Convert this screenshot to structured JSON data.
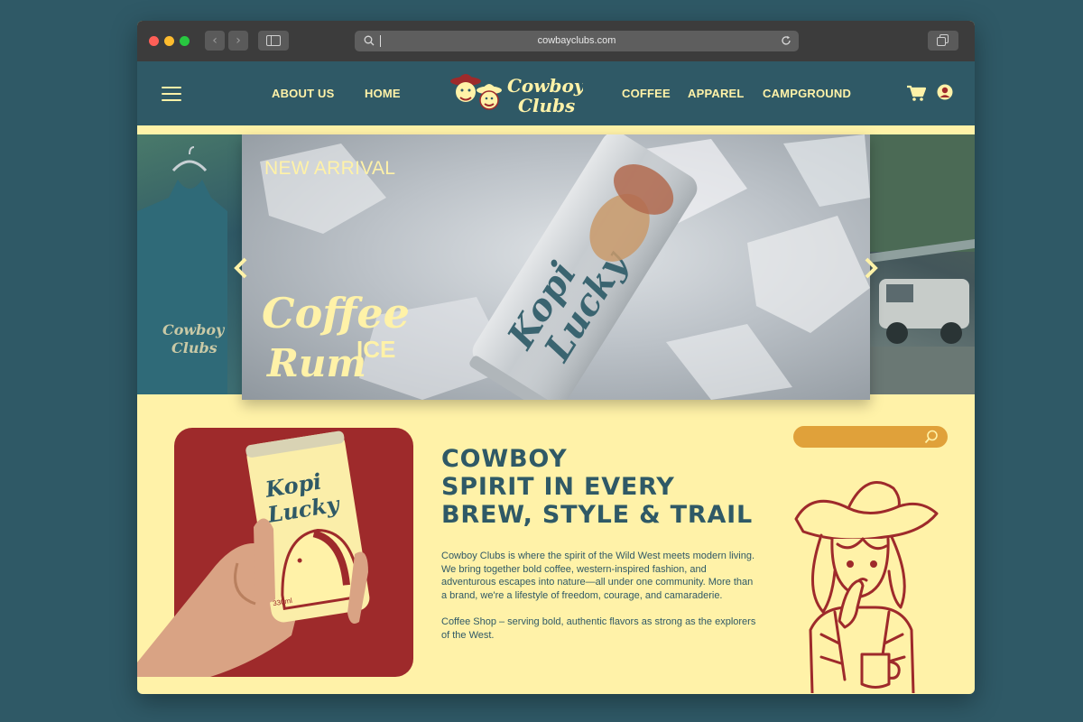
{
  "browser": {
    "url": "cowbayclubs.com",
    "back_glyph": "‹",
    "forward_glyph": "›"
  },
  "nav": {
    "links": [
      "ABOUT US",
      "HOME",
      "COFFEE",
      "APPAREL",
      "CAMPGROUND"
    ],
    "logo_text_1": "Cowboy",
    "logo_text_2": "Clubs",
    "icons": [
      "menu-icon",
      "cart-icon",
      "user-icon"
    ]
  },
  "hero": {
    "tag": "NEW ARRIVAL",
    "script_line_1": "Coffee",
    "script_line_2": "Rum",
    "ice": "ICE",
    "can_text_1": "Kopi",
    "can_text_2": "Lucky",
    "side_logo_1": "Cowboy",
    "side_logo_2": "Clubs"
  },
  "product": {
    "can_text_1": "Kopi",
    "can_text_2": "Lucky",
    "volume": "330ml"
  },
  "main": {
    "headline": [
      "COWBOY",
      "SPIRIT IN EVERY",
      "BREW, STYLE & TRAIL"
    ],
    "paragraph_1": "Cowboy Clubs is where the spirit of the Wild West meets modern living. We bring together bold coffee, western-inspired fashion, and adventurous escapes into nature—all under one community. More than a brand, we're a lifestyle of freedom, courage, and camaraderie.",
    "paragraph_2": "Coffee Shop – serving bold, authentic flavors as strong as the explorers of the West."
  },
  "colors": {
    "teal": "#2f5966",
    "cream": "#fff2a8",
    "red": "#9e2a2b",
    "mustard": "#e0a13a"
  }
}
